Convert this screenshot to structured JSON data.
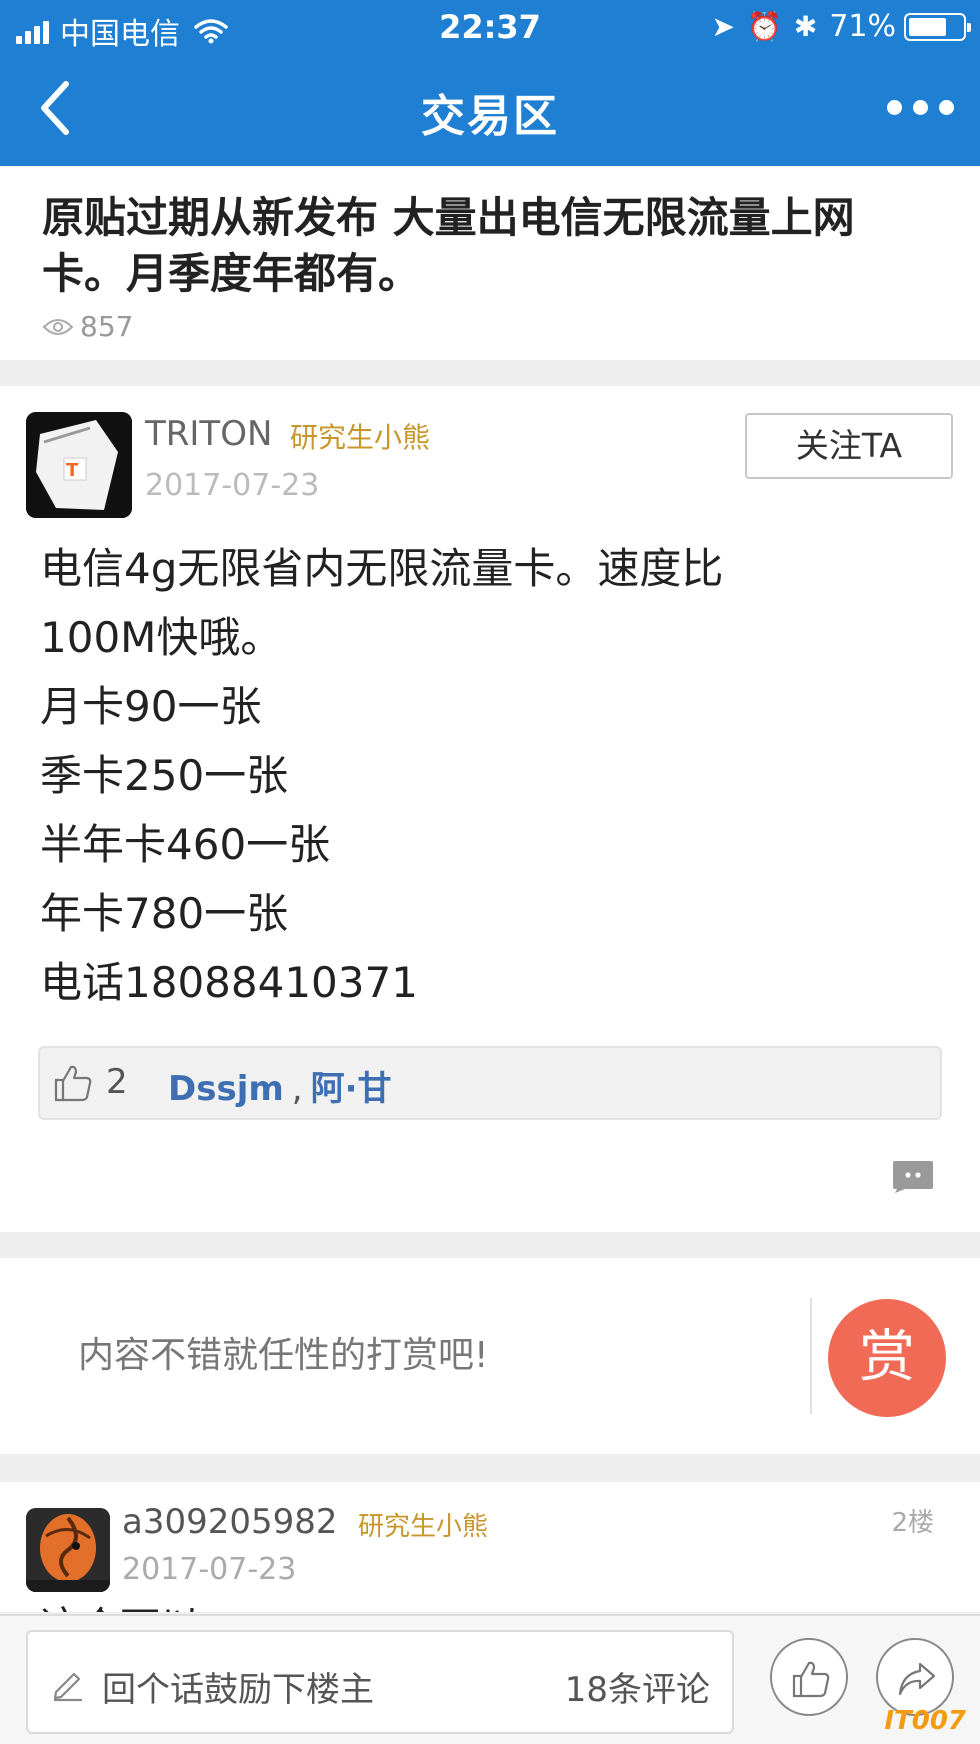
{
  "status_bar": {
    "carrier": "中国电信",
    "time": "22:37",
    "battery": "71%",
    "battery_level": 0.71
  },
  "nav": {
    "title": "交易区"
  },
  "post": {
    "title": "原贴过期从新发布 大量出电信无限流量上网卡。月季度年都有。",
    "views": "857",
    "author": "TRITON",
    "rank": "研究生小熊",
    "date": "2017-07-23",
    "follow_label": "关注TA",
    "body_lines": [
      "电信4g无限省内无限流量卡。速度比",
      "100M快哦。",
      "月卡90一张",
      "季卡250一张",
      "半年卡460一张",
      "年卡780一张",
      "电话18088410371"
    ],
    "like_count": "2",
    "likers": [
      "Dssjm",
      "阿·甘"
    ],
    "liker_separator": ","
  },
  "reward": {
    "prompt": "内容不错就任性的打赏吧!",
    "button_label": "赏"
  },
  "reply": {
    "author": "a309205982",
    "rank": "研究生小熊",
    "date": "2017-07-23",
    "floor": "2楼",
    "peek_text": "这个可以"
  },
  "bottom_bar": {
    "comment_placeholder": "回个话鼓励下楼主",
    "comment_count": "18条评论"
  },
  "watermark": "IT007",
  "colors": {
    "header_blue": "#1f7fd2",
    "rank_gold": "#c8962b",
    "link_blue": "#3d6fb2",
    "reward_red": "#f06a55"
  }
}
